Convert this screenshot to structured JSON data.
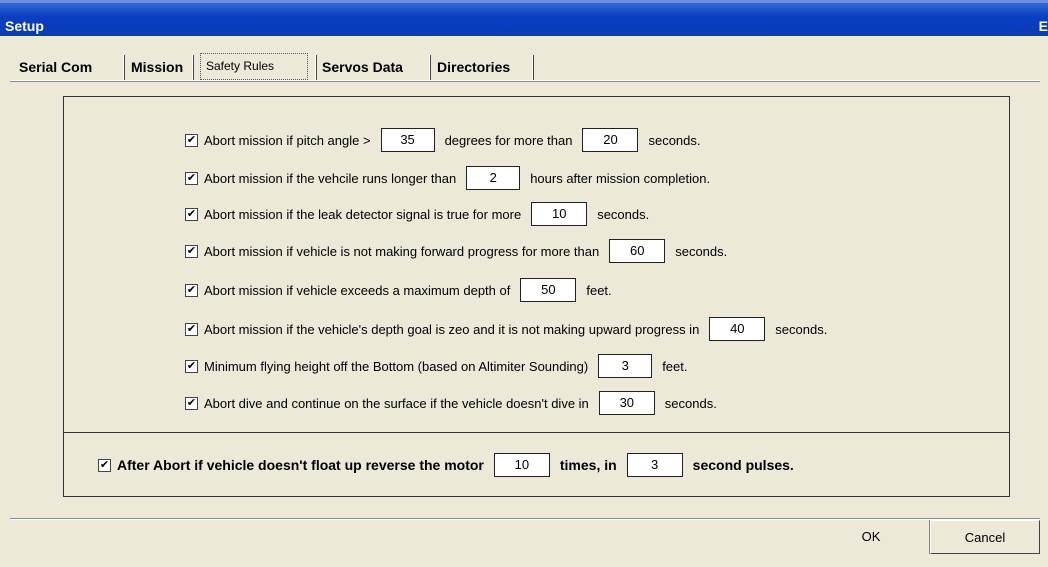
{
  "window": {
    "title": "Setup",
    "title_right": "E"
  },
  "tabs": [
    {
      "label": "Serial Com",
      "active": false
    },
    {
      "label": "Mission",
      "active": false
    },
    {
      "label": "Safety Rules",
      "active": true
    },
    {
      "label": "Servos Data",
      "active": false
    },
    {
      "label": "Directories",
      "active": false
    }
  ],
  "rules": [
    {
      "checked": true,
      "parts": [
        "Abort mission if pitch angle >",
        "35",
        "degrees for more than",
        "20",
        "seconds."
      ]
    },
    {
      "checked": true,
      "parts": [
        "Abort mission if the vehcile runs longer than",
        "2",
        "hours after mission completion."
      ]
    },
    {
      "checked": true,
      "parts": [
        "Abort mission if the leak detector signal is true for more",
        "10",
        "seconds."
      ]
    },
    {
      "checked": true,
      "parts": [
        "Abort mission if vehicle is not making forward progress for more than",
        "60",
        "seconds."
      ]
    },
    {
      "checked": true,
      "parts": [
        "Abort mission if vehicle exceeds a maximum depth of",
        "50",
        "feet."
      ]
    },
    {
      "checked": true,
      "parts": [
        "Abort mission if the vehicle's depth goal is zeo and it is not making upward progress in",
        "40",
        "seconds."
      ]
    },
    {
      "checked": true,
      "parts": [
        "Minimum flying height off the Bottom (based on Altimiter Sounding)",
        "3",
        "feet."
      ]
    },
    {
      "checked": true,
      "parts": [
        "Abort dive and continue on the surface if the vehicle doesn't dive in",
        "30",
        "seconds."
      ]
    }
  ],
  "after_abort": {
    "checked": true,
    "text1": "After Abort if vehicle doesn't float up reverse the motor",
    "times": "10",
    "text2": "times, in",
    "pulse": "3",
    "text3": "second pulses."
  },
  "buttons": {
    "ok": "OK",
    "cancel": "Cancel"
  },
  "check_glyph": "✔"
}
